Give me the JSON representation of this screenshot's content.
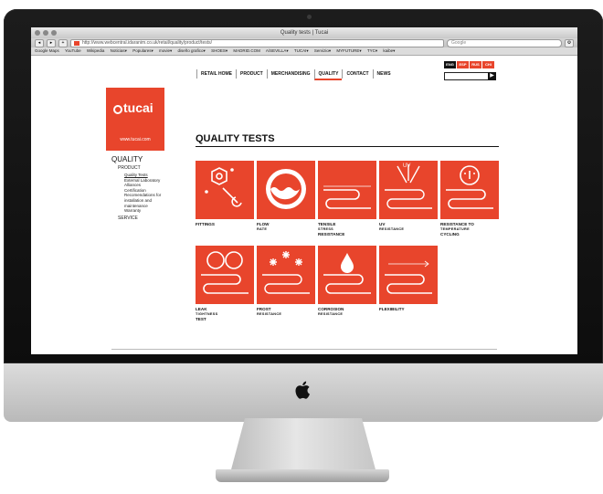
{
  "browser": {
    "title": "Quality tests | Tucai",
    "url": "http://www.webcentral.idaranim.co.uk/retail/quality/product/tests/",
    "search_placeholder": "Google",
    "bookmarks": [
      "Google Maps",
      "YouTube",
      "Wikipedia",
      "Noticias▾",
      "Populares▾",
      "movie▾",
      "diseño grafico▾",
      "SHOES▾",
      "MADRID.COM",
      "A/SEVILLA▾",
      "TUCAI▾",
      "Servizio▾",
      "MYFUTURE▾",
      "TYC▾",
      "kaibe▾"
    ]
  },
  "site": {
    "logo_text": "tucai",
    "logo_url": "www.tucai.com",
    "nav": [
      "RETAIL HOME",
      "PRODUCT",
      "MERCHANDISING",
      "QUALITY",
      "CONTACT",
      "NEWS"
    ],
    "languages": [
      "ENG",
      "ESP",
      "RUS",
      "CHI"
    ],
    "search_button": "▶"
  },
  "sidebar": {
    "title": "QUALITY",
    "section": "PRODUCT",
    "items": [
      "Quality Tests",
      "External Laboratory",
      "Alliances",
      "Certification",
      "Recomendations for",
      "installation and",
      "maintenance",
      "Warranty"
    ],
    "service": "SERVICE"
  },
  "main": {
    "heading": "QUALITY TESTS",
    "tiles": [
      {
        "title": "FITTINGS",
        "sub": "",
        "sub2": ""
      },
      {
        "title": "FLOW",
        "sub": "RATE",
        "sub2": ""
      },
      {
        "title": "TENSILE",
        "sub": "STRESS",
        "sub2": "RESISTANCE"
      },
      {
        "title": "UV",
        "sub": "RESISTANCE",
        "sub2": ""
      },
      {
        "title": "RESISTANCE TO",
        "sub": "TEMPERATURE",
        "sub2": "CYCLING"
      },
      {
        "title": "LEAK",
        "sub": "TIGHTNESS",
        "sub2": "TEST"
      },
      {
        "title": "FROST",
        "sub": "RESISTANCE",
        "sub2": ""
      },
      {
        "title": "CORROSION",
        "sub": "RESISTANCE",
        "sub2": ""
      },
      {
        "title": "FLEXIBILITY",
        "sub": "",
        "sub2": ""
      }
    ],
    "uv_label": "UV"
  },
  "colors": {
    "brand": "#e8452c",
    "bezel": "#111111"
  }
}
